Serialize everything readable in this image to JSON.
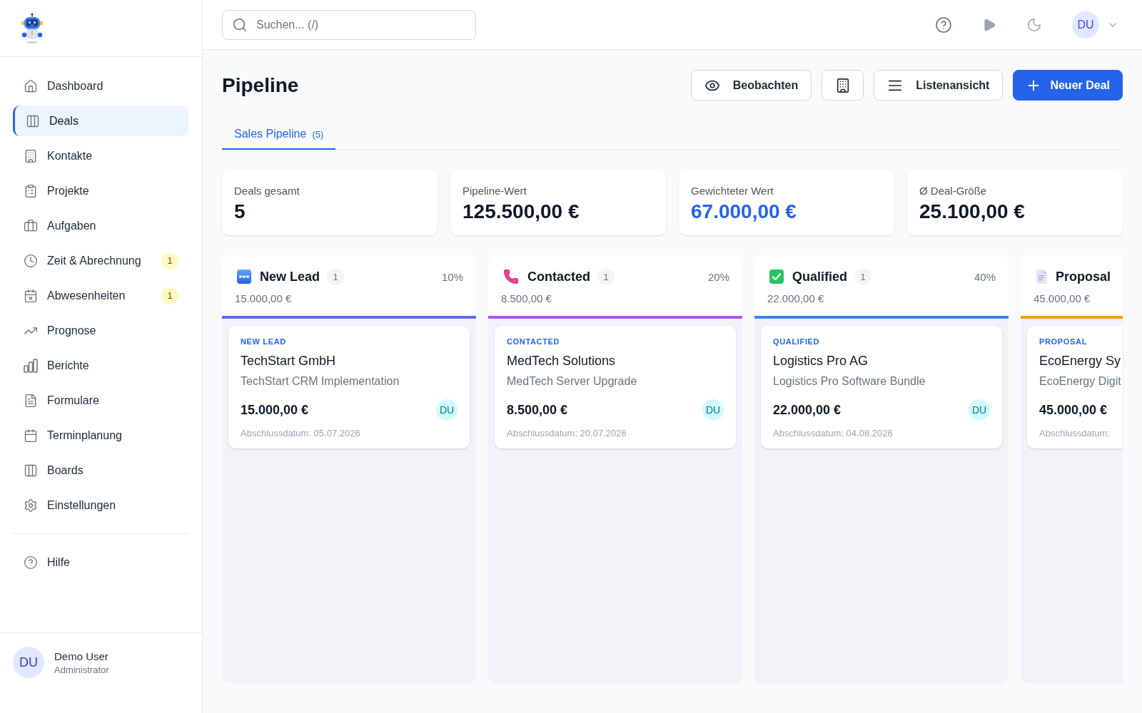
{
  "sidebar": {
    "nav": [
      {
        "label": "Dashboard",
        "selected": false
      },
      {
        "label": "Deals",
        "selected": true
      },
      {
        "label": "Kontakte",
        "selected": false
      },
      {
        "label": "Projekte",
        "selected": false
      },
      {
        "label": "Aufgaben",
        "selected": false
      },
      {
        "label": "Zeit & Abrechnung",
        "selected": false,
        "badge": "1"
      },
      {
        "label": "Abwesenheiten",
        "selected": false,
        "badge": "1"
      },
      {
        "label": "Prognose",
        "selected": false
      },
      {
        "label": "Berichte",
        "selected": false
      },
      {
        "label": "Formulare",
        "selected": false
      },
      {
        "label": "Terminplanung",
        "selected": false
      },
      {
        "label": "Boards",
        "selected": false
      },
      {
        "label": "Einstellungen",
        "selected": false
      }
    ],
    "secondary_nav": [
      {
        "label": "Hilfe",
        "selected": false
      }
    ],
    "user": {
      "initials": "DU",
      "name": "Demo User",
      "role": "Administrator"
    }
  },
  "header": {
    "search": {
      "placeholder": "Suchen... (/)"
    },
    "avatar": "DU"
  },
  "page": {
    "title": "Pipeline",
    "actions": [
      {
        "kind": "outline",
        "label": "Beobachten"
      },
      {
        "kind": "icon"
      },
      {
        "kind": "outline",
        "label": "Listenansicht"
      },
      {
        "kind": "primary",
        "label": "Neuer Deal"
      }
    ]
  },
  "tabs": [
    {
      "label": "Sales Pipeline",
      "count": "(5)",
      "selected": true
    }
  ],
  "stats": [
    {
      "label": "Deals gesamt",
      "value": "5",
      "highlighted": false
    },
    {
      "label": "Pipeline-Wert",
      "value": "125.500,00 €",
      "highlighted": false
    },
    {
      "label": "Gewichteter Wert",
      "value": "67.000,00 €",
      "highlighted": true
    },
    {
      "label": "Ø Deal-Größe",
      "value": "25.100,00 €",
      "highlighted": false
    }
  ],
  "stages": [
    {
      "title": "New Lead",
      "count": "1",
      "percent": "10%",
      "amount": "15.000,00 €",
      "color": "#6366f1",
      "deals": [
        {
          "stage": "NEW LEAD",
          "company": "TechStart GmbH",
          "title": "TechStart CRM Implementation",
          "amount": "15.000,00 €",
          "owner": "DU",
          "close_date": "Abschlussdatum: 05.07.2026"
        }
      ]
    },
    {
      "title": "Contacted",
      "count": "1",
      "percent": "20%",
      "amount": "8.500,00 €",
      "color": "#a855f7",
      "deals": [
        {
          "stage": "CONTACTED",
          "company": "MedTech Solutions",
          "title": "MedTech Server Upgrade",
          "amount": "8.500,00 €",
          "owner": "DU",
          "close_date": "Abschlussdatum: 20.07.2026"
        }
      ]
    },
    {
      "title": "Qualified",
      "count": "1",
      "percent": "40%",
      "amount": "22.000,00 €",
      "color": "#3b82f6",
      "deals": [
        {
          "stage": "QUALIFIED",
          "company": "Logistics Pro AG",
          "title": "Logistics Pro Software Bundle",
          "amount": "22.000,00 €",
          "owner": "DU",
          "close_date": "Abschlussdatum: 04.08.2026"
        }
      ]
    },
    {
      "title": "Proposal",
      "amount": "45.000,00 €",
      "color": "#f59e0b",
      "deals": [
        {
          "stage": "PROPOSAL",
          "company": "EcoEnergy Sy",
          "title": "EcoEnergy Digit",
          "amount": "45.000,00 €",
          "close_date": "Abschlussdatum:"
        }
      ]
    }
  ]
}
